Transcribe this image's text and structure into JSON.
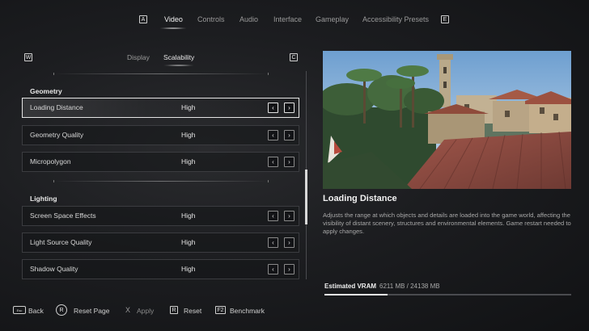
{
  "top_nav": {
    "left_key": "A",
    "right_key": "E",
    "tabs": [
      "Video",
      "Controls",
      "Audio",
      "Interface",
      "Gameplay",
      "Accessibility Presets"
    ],
    "active_tab": "Video"
  },
  "sub_nav": {
    "left_key": "W",
    "right_key": "C",
    "tabs": [
      "Display",
      "Scalability"
    ],
    "active_tab": "Scalability"
  },
  "sections": [
    {
      "title": "Geometry",
      "settings": [
        {
          "label": "Loading Distance",
          "value": "High",
          "selected": true
        },
        {
          "label": "Geometry Quality",
          "value": "High"
        },
        {
          "label": "Micropolygon",
          "value": "High"
        }
      ]
    },
    {
      "title": "Lighting",
      "settings": [
        {
          "label": "Screen Space Effects",
          "value": "High"
        },
        {
          "label": "Light Source Quality",
          "value": "High"
        },
        {
          "label": "Shadow Quality",
          "value": "High"
        }
      ]
    }
  ],
  "arrows": {
    "left": "‹",
    "right": "›"
  },
  "detail": {
    "title": "Loading Distance",
    "description": "Adjusts the range at which objects and details are loaded into the game world, affecting the visibility of distant scenery, structures and environmental elements. Game restart needed to apply changes."
  },
  "vram": {
    "label": "Estimated VRAM",
    "value": "6211 MB / 24138 MB",
    "fraction": 0.257
  },
  "footer": {
    "back_key": "Esc",
    "back": "Back",
    "reset_page_key": "R",
    "reset_page": "Reset Page",
    "apply_key": "X",
    "apply": "Apply",
    "reset_key": "R",
    "reset": "Reset",
    "benchmark_key": "F2",
    "benchmark": "Benchmark"
  },
  "colors": {
    "background": "#1c1d20",
    "text": "#e6e6e6",
    "muted": "#9a9a9a",
    "selected_border": "#e4e4e4"
  }
}
